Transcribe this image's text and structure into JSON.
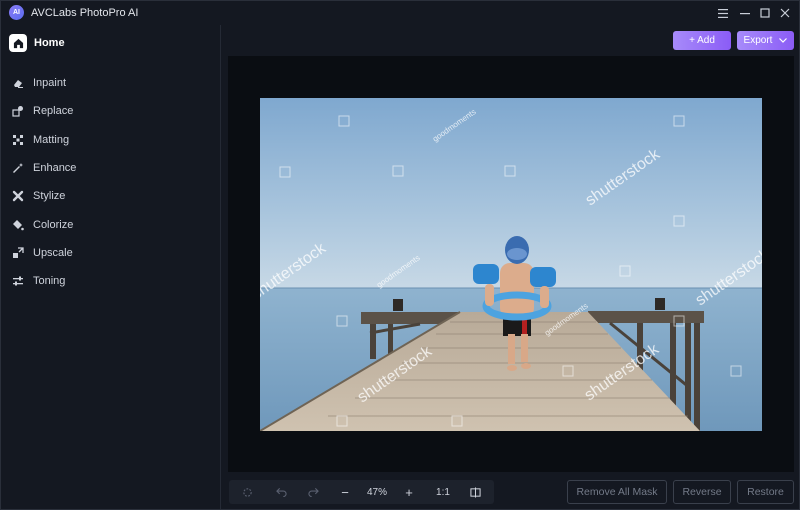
{
  "app": {
    "title": "AVCLabs PhotoPro AI",
    "logo_text": "AI"
  },
  "window_controls": {
    "menu": "≡",
    "minimize": "—",
    "maximize": "□",
    "close": "✕"
  },
  "sidebar": {
    "home_label": "Home",
    "items": [
      {
        "label": "Inpaint",
        "icon": "eraser-icon"
      },
      {
        "label": "Replace",
        "icon": "replace-icon"
      },
      {
        "label": "Matting",
        "icon": "matting-icon"
      },
      {
        "label": "Enhance",
        "icon": "enhance-icon"
      },
      {
        "label": "Stylize",
        "icon": "stylize-icon"
      },
      {
        "label": "Colorize",
        "icon": "colorize-icon"
      },
      {
        "label": "Upscale",
        "icon": "upscale-icon"
      },
      {
        "label": "Toning",
        "icon": "toning-icon"
      }
    ]
  },
  "toolbar": {
    "add_label": "+ Add",
    "export_label": "Export"
  },
  "photo": {
    "watermark_main": "shutterstock",
    "watermark_credit": "goodmoments"
  },
  "zoom": {
    "level": "47%",
    "ratio": "1:1",
    "minus": "−",
    "plus": "+"
  },
  "actions": {
    "remove_all_mask": "Remove All Mask",
    "reverse": "Reverse",
    "restore": "Restore"
  },
  "colors": {
    "accent_start": "#a78bfa",
    "accent_end": "#8b5cf6",
    "background": "#141821",
    "canvas": "#0a0d12"
  }
}
